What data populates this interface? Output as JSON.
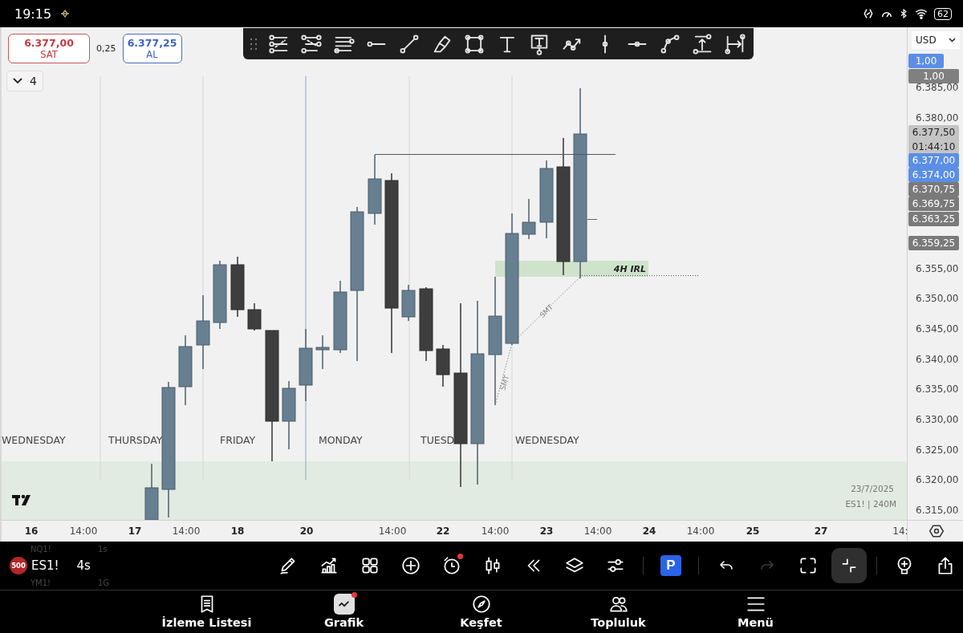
{
  "status_bar": {
    "time": "19:15",
    "battery": "62"
  },
  "quote": {
    "sell": {
      "price": "6.377,00",
      "label": "SAT"
    },
    "spread": "0,25",
    "buy": {
      "price": "6.377,25",
      "label": "AL"
    }
  },
  "interval_button": {
    "label": "4",
    "expanded": false
  },
  "chart": {
    "day_labels": [
      "WEDNESDAY",
      "THURSDAY",
      "FRIDAY",
      "MONDAY",
      "TUESD",
      "WEDNESDAY"
    ],
    "zone_label": "4H IRL",
    "smt_labels": [
      "SMT",
      "SMT"
    ],
    "info": {
      "date": "23/7/2025",
      "symbol": "ES1! | 240M"
    }
  },
  "price_axis": {
    "currency": "USD",
    "tags": [
      {
        "lines": [
          "1,00"
        ],
        "color": "#5b8ee6"
      },
      {
        "lines": [
          "1,00"
        ],
        "color": "#808080"
      },
      {
        "lines": [
          "6.377,50",
          "01:44:10"
        ],
        "color": "#c4c4c4"
      },
      {
        "lines": [
          "6.377,00"
        ],
        "color": "#5b8ee6"
      },
      {
        "lines": [
          "6.374,00"
        ],
        "color": "#5b8ee6"
      },
      {
        "lines": [
          "6.370,75"
        ],
        "color": "#7a7a7a"
      },
      {
        "lines": [
          "6.369,75"
        ],
        "color": "#7a7a7a"
      },
      {
        "lines": [
          "6.363,25"
        ],
        "color": "#7a7a7a"
      },
      {
        "lines": [
          "6.359,25"
        ],
        "color": "#7a7a7a"
      }
    ],
    "ticks": [
      "6.385,00",
      "6.380,00",
      "6.355,00",
      "6.350,00",
      "6.345,00",
      "6.340,00",
      "6.335,00",
      "6.330,00",
      "6.325,00",
      "6.320,00",
      "6.315,00"
    ]
  },
  "time_axis": [
    {
      "text": "16",
      "kind": "date"
    },
    {
      "text": "14:00",
      "kind": "time"
    },
    {
      "text": "17",
      "kind": "date"
    },
    {
      "text": "14:00",
      "kind": "time"
    },
    {
      "text": "18",
      "kind": "date"
    },
    {
      "text": "20",
      "kind": "date"
    },
    {
      "text": "14:00",
      "kind": "time"
    },
    {
      "text": "22",
      "kind": "date"
    },
    {
      "text": "14:00",
      "kind": "time"
    },
    {
      "text": "23",
      "kind": "date"
    },
    {
      "text": "14:00",
      "kind": "time"
    },
    {
      "text": "24",
      "kind": "date"
    },
    {
      "text": "14:00",
      "kind": "time"
    },
    {
      "text": "25",
      "kind": "date"
    },
    {
      "text": "27",
      "kind": "date"
    },
    {
      "text": "14:",
      "kind": "time"
    }
  ],
  "symbols": [
    {
      "symbol": "NQ1!",
      "interval": "1s",
      "selected": false
    },
    {
      "badge": "500",
      "symbol": "ES1!",
      "interval": "4s",
      "selected": true
    },
    {
      "symbol": "YM1!",
      "interval": "1G",
      "selected": false
    }
  ],
  "tool_buttons": [
    {
      "kind": "pencil",
      "selected": false,
      "disabled": false,
      "alert": false
    },
    {
      "kind": "indicators",
      "selected": false,
      "disabled": false,
      "alert": false
    },
    {
      "kind": "grid",
      "selected": false,
      "disabled": false,
      "alert": false
    },
    {
      "kind": "plus",
      "selected": false,
      "disabled": false,
      "alert": false
    },
    {
      "kind": "alarm",
      "selected": false,
      "disabled": false,
      "alert": true
    },
    {
      "kind": "candles",
      "selected": false,
      "disabled": false,
      "alert": false
    },
    {
      "kind": "rewind",
      "selected": false,
      "disabled": false,
      "alert": false
    },
    {
      "kind": "layers",
      "selected": false,
      "disabled": false,
      "alert": false
    },
    {
      "kind": "sliders",
      "selected": false,
      "disabled": false,
      "alert": false
    },
    {
      "kind": "divider"
    },
    {
      "kind": "logo",
      "label": "P"
    },
    {
      "kind": "divider"
    },
    {
      "kind": "undo",
      "selected": false,
      "disabled": false,
      "alert": false
    },
    {
      "kind": "redo",
      "selected": false,
      "disabled": true,
      "alert": false
    },
    {
      "kind": "fullscreen",
      "selected": false,
      "disabled": false,
      "alert": false
    },
    {
      "kind": "collapse",
      "selected": true,
      "disabled": false,
      "alert": false
    },
    {
      "kind": "divider"
    },
    {
      "kind": "bulb",
      "selected": false,
      "disabled": false,
      "alert": false
    },
    {
      "kind": "share",
      "selected": false,
      "disabled": false,
      "alert": false
    }
  ],
  "nav": [
    {
      "kind": "watchlist",
      "label": "İzleme Listesi",
      "selected": false,
      "alert": false
    },
    {
      "kind": "chart",
      "label": "Grafik",
      "selected": true,
      "alert": true
    },
    {
      "kind": "explore",
      "label": "Keşfet",
      "selected": false,
      "alert": false
    },
    {
      "kind": "community",
      "label": "Topluluk",
      "selected": false,
      "alert": false
    },
    {
      "kind": "menu",
      "label": "Menü",
      "selected": false,
      "alert": false
    }
  ]
}
